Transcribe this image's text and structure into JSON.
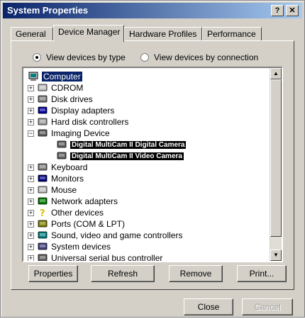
{
  "window": {
    "title": "System Properties",
    "help_glyph": "?",
    "close_glyph": "✕"
  },
  "tabs": [
    {
      "label": "General"
    },
    {
      "label": "Device Manager"
    },
    {
      "label": "Hardware Profiles"
    },
    {
      "label": "Performance"
    }
  ],
  "view": {
    "by_type": "View devices by type",
    "by_connection": "View devices by connection",
    "selected": "by_type"
  },
  "tree": {
    "root": "Computer",
    "items": [
      {
        "label": "CDROM",
        "icon": "cdrom-icon",
        "expander": "+"
      },
      {
        "label": "Disk drives",
        "icon": "disk-drive-icon",
        "expander": "+"
      },
      {
        "label": "Display adapters",
        "icon": "display-adapter-icon",
        "expander": "+"
      },
      {
        "label": "Hard disk controllers",
        "icon": "hard-disk-controller-icon",
        "expander": "+"
      },
      {
        "label": "Imaging Device",
        "icon": "camera-icon",
        "expander": "−"
      },
      {
        "label": "Digital MultiCam II Digital Camera",
        "icon": "camera-icon",
        "child": true
      },
      {
        "label": "Digital MultiCam II Video Camera",
        "icon": "camera-icon",
        "child": true
      },
      {
        "label": "Keyboard",
        "icon": "keyboard-icon",
        "expander": "+"
      },
      {
        "label": "Monitors",
        "icon": "monitor-icon",
        "expander": "+"
      },
      {
        "label": "Mouse",
        "icon": "mouse-icon",
        "expander": "+"
      },
      {
        "label": "Network adapters",
        "icon": "network-adapter-icon",
        "expander": "+"
      },
      {
        "label": "Other devices",
        "icon": "question-mark-icon",
        "expander": "+"
      },
      {
        "label": "Ports (COM & LPT)",
        "icon": "port-icon",
        "expander": "+"
      },
      {
        "label": "Sound, video and game controllers",
        "icon": "sound-icon",
        "expander": "+"
      },
      {
        "label": "System devices",
        "icon": "system-device-icon",
        "expander": "+"
      },
      {
        "label": "Universal serial bus controller",
        "icon": "usb-icon",
        "expander": "+"
      }
    ]
  },
  "buttons": {
    "properties": "Properties",
    "refresh": "Refresh",
    "remove": "Remove",
    "print": "Print...",
    "close": "Close",
    "cancel": "Cancel"
  },
  "colors": {
    "title_bar": "#0a246a",
    "selection": "#0a246a",
    "device_highlight": "#000000"
  }
}
